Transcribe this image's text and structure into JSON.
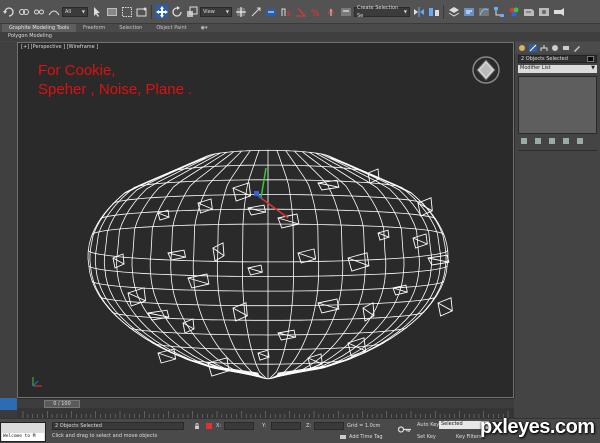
{
  "toolbar": {
    "filter_select": "All",
    "view_select": "View",
    "selection_set": "Create Selection Se"
  },
  "ribbon": {
    "tabs": [
      "Graphite Modeling Tools",
      "Freeform",
      "Selection",
      "Object Paint"
    ],
    "extra": "◉▾",
    "sub_title": "Polygon Modeling"
  },
  "viewport": {
    "label": "[+] [Perspective ] [Wireframe ]",
    "overlay_line1": "For Cookie,",
    "overlay_line2": "Speher , Noise, Plane .",
    "wire_color": "#ffffff",
    "overlay_color": "#e01010"
  },
  "command_panel": {
    "selection_field": "2 Objects Selected",
    "modifier_list": "Modifier List"
  },
  "timeline": {
    "slider": "0 / 100",
    "ruler_ticks": [
      "0",
      "5",
      "10",
      "15",
      "20",
      "25",
      "30",
      "35",
      "40",
      "45",
      "50",
      "55",
      "60",
      "65",
      "70",
      "75",
      "80",
      "85",
      "90",
      "95",
      "100"
    ]
  },
  "status": {
    "maxscript": "Welcome to M",
    "selection_count": "2 Objects Selected",
    "prompt": "Click and drag to select and move objects",
    "x_label": "X:",
    "y_label": "Y:",
    "z_label": "Z:",
    "grid": "Grid = 1.0cm",
    "add_time_tag": "Add Time Tag",
    "auto_key": "Auto Key",
    "selected": "Selected",
    "set_key": "Set Key",
    "key_filters": "Key Filters..."
  },
  "watermark": "pxleyes.com"
}
